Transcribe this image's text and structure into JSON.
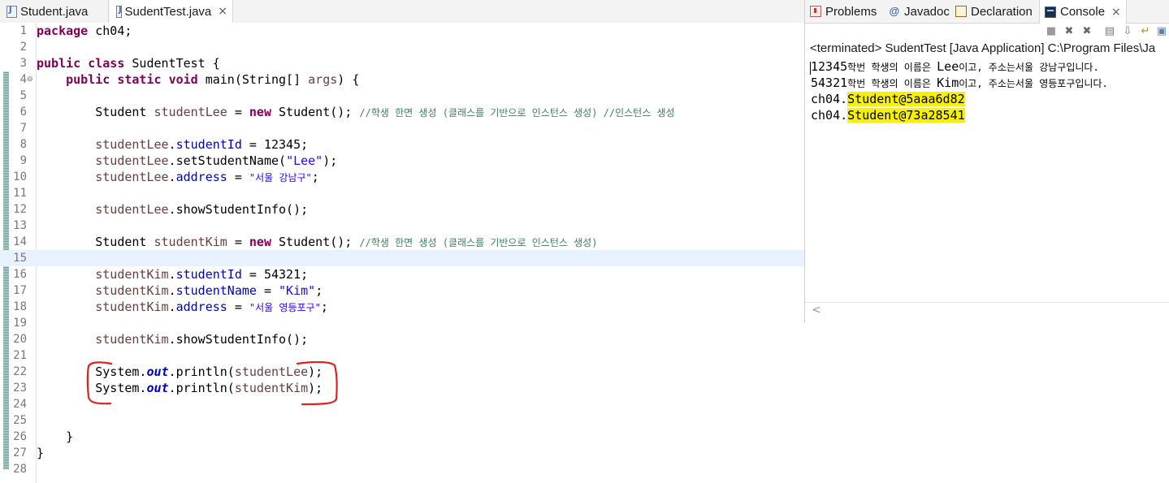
{
  "editor": {
    "tabs": [
      {
        "label": "Student.java",
        "active": false
      },
      {
        "label": "SudentTest.java",
        "active": true
      }
    ],
    "close_glyph": "×",
    "lines": [
      {
        "num": "1",
        "segs": [
          {
            "t": "package",
            "c": "kw"
          },
          {
            "t": " ch04;"
          }
        ]
      },
      {
        "num": "2",
        "segs": []
      },
      {
        "num": "3",
        "segs": [
          {
            "t": "public",
            "c": "kw"
          },
          {
            "t": " "
          },
          {
            "t": "class",
            "c": "kw"
          },
          {
            "t": " SudentTest {"
          }
        ]
      },
      {
        "num": "4",
        "fold": "⊖",
        "segs": [
          {
            "t": "    "
          },
          {
            "t": "public",
            "c": "kw"
          },
          {
            "t": " "
          },
          {
            "t": "static",
            "c": "kw"
          },
          {
            "t": " "
          },
          {
            "t": "void",
            "c": "kw"
          },
          {
            "t": " main(String[] "
          },
          {
            "t": "args",
            "c": "lv"
          },
          {
            "t": ") {"
          }
        ]
      },
      {
        "num": "5",
        "segs": []
      },
      {
        "num": "6",
        "segs": [
          {
            "t": "        Student "
          },
          {
            "t": "studentLee",
            "c": "lv"
          },
          {
            "t": " = "
          },
          {
            "t": "new",
            "c": "kw"
          },
          {
            "t": " Student(); "
          },
          {
            "t": "//학생 한면 생성 (클래스를 기반으로 인스턴스 생성) //인스턴스 생성",
            "c": "cmt kor"
          }
        ]
      },
      {
        "num": "7",
        "segs": []
      },
      {
        "num": "8",
        "segs": [
          {
            "t": "        "
          },
          {
            "t": "studentLee",
            "c": "lv"
          },
          {
            "t": "."
          },
          {
            "t": "studentId",
            "c": "fld"
          },
          {
            "t": " = 12345;"
          }
        ]
      },
      {
        "num": "9",
        "segs": [
          {
            "t": "        "
          },
          {
            "t": "studentLee",
            "c": "lv"
          },
          {
            "t": ".setStudentName("
          },
          {
            "t": "\"Lee\"",
            "c": "str"
          },
          {
            "t": ");"
          }
        ]
      },
      {
        "num": "10",
        "segs": [
          {
            "t": "        "
          },
          {
            "t": "studentLee",
            "c": "lv"
          },
          {
            "t": "."
          },
          {
            "t": "address",
            "c": "fld"
          },
          {
            "t": " = "
          },
          {
            "t": "\"서울 강남구\"",
            "c": "str kor"
          },
          {
            "t": ";"
          }
        ]
      },
      {
        "num": "11",
        "segs": []
      },
      {
        "num": "12",
        "segs": [
          {
            "t": "        "
          },
          {
            "t": "studentLee",
            "c": "lv"
          },
          {
            "t": ".showStudentInfo();"
          }
        ]
      },
      {
        "num": "13",
        "segs": []
      },
      {
        "num": "14",
        "segs": [
          {
            "t": "        Student "
          },
          {
            "t": "studentKim",
            "c": "lv"
          },
          {
            "t": " = "
          },
          {
            "t": "new",
            "c": "kw"
          },
          {
            "t": " Student(); "
          },
          {
            "t": "//학생 한면 생성 (클래스를 기반으로 인스턴스 생성)",
            "c": "cmt kor"
          }
        ]
      },
      {
        "num": "15",
        "current": true,
        "segs": []
      },
      {
        "num": "16",
        "segs": [
          {
            "t": "        "
          },
          {
            "t": "studentKim",
            "c": "lv"
          },
          {
            "t": "."
          },
          {
            "t": "studentId",
            "c": "fld"
          },
          {
            "t": " = 54321;"
          }
        ]
      },
      {
        "num": "17",
        "segs": [
          {
            "t": "        "
          },
          {
            "t": "studentKim",
            "c": "lv"
          },
          {
            "t": "."
          },
          {
            "t": "studentName",
            "c": "fld"
          },
          {
            "t": " = "
          },
          {
            "t": "\"Kim\"",
            "c": "str"
          },
          {
            "t": ";"
          }
        ]
      },
      {
        "num": "18",
        "segs": [
          {
            "t": "        "
          },
          {
            "t": "studentKim",
            "c": "lv"
          },
          {
            "t": "."
          },
          {
            "t": "address",
            "c": "fld"
          },
          {
            "t": " = "
          },
          {
            "t": "\"서울 영등포구\"",
            "c": "str kor"
          },
          {
            "t": ";"
          }
        ]
      },
      {
        "num": "19",
        "segs": []
      },
      {
        "num": "20",
        "segs": [
          {
            "t": "        "
          },
          {
            "t": "studentKim",
            "c": "lv"
          },
          {
            "t": ".showStudentInfo();"
          }
        ]
      },
      {
        "num": "21",
        "segs": []
      },
      {
        "num": "22",
        "segs": [
          {
            "t": "        System."
          },
          {
            "t": "out",
            "c": "sfld"
          },
          {
            "t": ".println("
          },
          {
            "t": "studentLee",
            "c": "lv"
          },
          {
            "t": ");"
          }
        ]
      },
      {
        "num": "23",
        "segs": [
          {
            "t": "        System."
          },
          {
            "t": "out",
            "c": "sfld"
          },
          {
            "t": ".println("
          },
          {
            "t": "studentKim",
            "c": "lv"
          },
          {
            "t": ");"
          }
        ]
      },
      {
        "num": "24",
        "segs": []
      },
      {
        "num": "25",
        "segs": []
      },
      {
        "num": "26",
        "segs": [
          {
            "t": "    }"
          }
        ]
      },
      {
        "num": "27",
        "segs": [
          {
            "t": "}"
          }
        ]
      },
      {
        "num": "28",
        "segs": []
      }
    ]
  },
  "console": {
    "tabs": [
      {
        "label": "Problems",
        "icon": "problems-icon"
      },
      {
        "label": "Javadoc",
        "icon": "javadoc-icon",
        "glyph": "@"
      },
      {
        "label": "Declaration",
        "icon": "declaration-icon"
      },
      {
        "label": "Console",
        "icon": "console-icon",
        "active": true
      }
    ],
    "close_glyph": "×",
    "status": "<terminated> SudentTest [Java Application] C:\\Program Files\\Ja",
    "output": [
      {
        "segs": [
          {
            "t": "12345"
          },
          {
            "t": "학번 학생의 이름은 ",
            "c": "kor"
          },
          {
            "t": "Lee"
          },
          {
            "t": "이고, 주소는서울 강남구입니다.",
            "c": "kor"
          }
        ]
      },
      {
        "segs": [
          {
            "t": "54321"
          },
          {
            "t": "학번 학생의 이름은 ",
            "c": "kor"
          },
          {
            "t": "Kim"
          },
          {
            "t": "이고, 주소는서울 영등포구입니다.",
            "c": "kor"
          }
        ]
      },
      {
        "segs": [
          {
            "t": "ch04."
          },
          {
            "t": "Student@5aaa6d82",
            "c": "hl"
          }
        ]
      },
      {
        "segs": [
          {
            "t": "ch04."
          },
          {
            "t": "Student@73a28541",
            "c": "hl"
          }
        ]
      }
    ],
    "scroll_left_glyph": "<"
  },
  "colors": {
    "annotation_red": "#e0201c",
    "highlight_yellow": "#f7f000",
    "keyword": "#7f0055",
    "field": "#0000c0",
    "string": "#2a00ff",
    "comment": "#3f7f5f"
  }
}
